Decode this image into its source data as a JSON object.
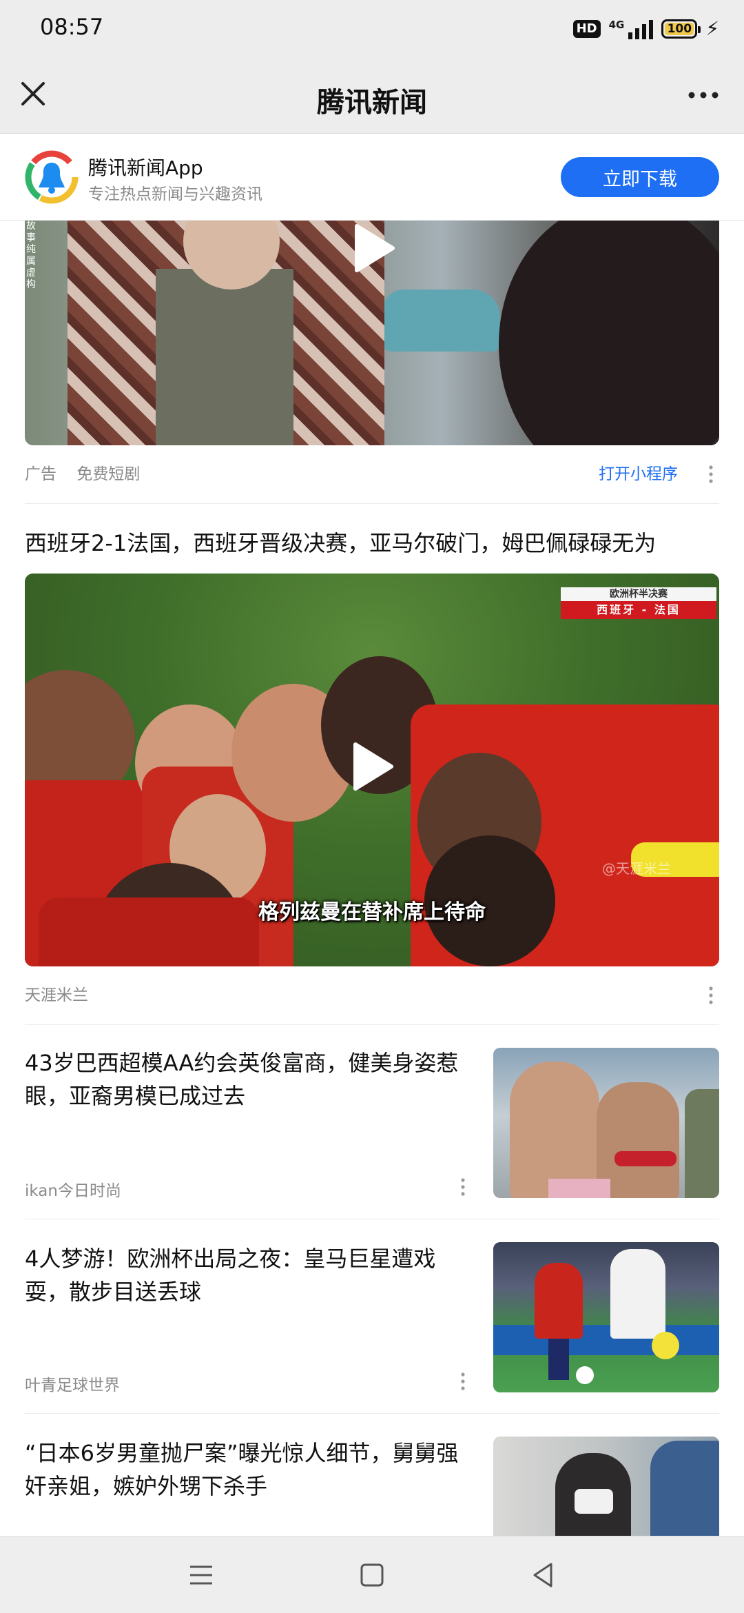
{
  "status_bar": {
    "time": "08:57",
    "hd_label": "HD",
    "network_label": "4G",
    "battery_level": "100"
  },
  "title_bar": {
    "title": "腾讯新闻"
  },
  "app_banner": {
    "app_name": "腾讯新闻App",
    "app_desc": "专注热点新闻与兴趣资讯",
    "download_label": "立即下载"
  },
  "ad_card": {
    "side_note": "故事纯属虚构",
    "ad_label": "广告",
    "category": "免费短剧",
    "open_link": "打开小程序"
  },
  "video_card": {
    "headline": "西班牙2-1法国，西班牙晋级决赛，亚马尔破门，姆巴佩碌碌无为",
    "badge_top": "欧洲杯半决赛",
    "badge_bottom": "西班牙 - 法国",
    "subtitle": "格列兹曼在替补席上待命",
    "watermark": "@天涯米兰",
    "source": "天涯米兰"
  },
  "news_items": [
    {
      "title": "43岁巴西超模AA约会英俊富商，健美身姿惹眼，亚裔男模已成过去",
      "source": "ikan今日时尚"
    },
    {
      "title": "4人梦游！欧洲杯出局之夜：皇马巨星遭戏耍，散步目送丢球",
      "source": "叶青足球世界"
    },
    {
      "title": "“日本6岁男童抛尸案”曝光惊人细节，舅舅强奸亲姐，嫉妒外甥下杀手",
      "source": ""
    }
  ],
  "colors": {
    "accent": "#1e6ff3",
    "bar_background": "#ededed",
    "muted_text": "#8a8a8a"
  }
}
